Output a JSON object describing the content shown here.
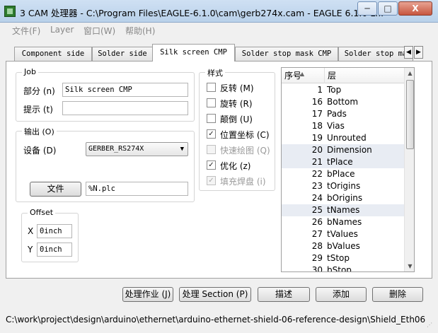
{
  "window": {
    "title": "3 CAM 处理器 - C:\\Program Files\\EAGLE-6.1.0\\cam\\gerb274x.cam - EAGLE 6.1.0 L...",
    "min_label": "─",
    "max_label": "□",
    "close_label": "X"
  },
  "menu": [
    "文件(F)",
    "Layer",
    "窗口(W)",
    "帮助(H)"
  ],
  "tabs": {
    "items": [
      "Component side",
      "Solder side",
      "Silk screen CMP",
      "Solder stop mask CMP",
      "Solder stop ma"
    ],
    "active": "Silk screen CMP",
    "scroll_right": "▶"
  },
  "job": {
    "title": "Job",
    "section_label": "部分 (n)",
    "section_value": "Silk screen CMP",
    "prompt_label": "提示 (t)",
    "prompt_value": ""
  },
  "output": {
    "title": "输出 (O)",
    "device_label": "设备 (D)",
    "device_value": "GERBER_RS274X",
    "file_button": "文件",
    "file_value": "%N.plc"
  },
  "offset": {
    "title": "Offset",
    "x_label": "X",
    "x_value": "0inch",
    "y_label": "Y",
    "y_value": "0inch"
  },
  "style": {
    "title": "样式",
    "options": [
      {
        "label": "反转 (M)",
        "checked": false,
        "enabled": true
      },
      {
        "label": "旋转 (R)",
        "checked": false,
        "enabled": true
      },
      {
        "label": "颠倒 (U)",
        "checked": false,
        "enabled": true
      },
      {
        "label": "位置坐标 (C)",
        "checked": true,
        "enabled": true
      },
      {
        "label": "快速绘图 (Q)",
        "checked": false,
        "enabled": false
      },
      {
        "label": "优化 (z)",
        "checked": true,
        "enabled": true
      },
      {
        "label": "填充焊盘 (i)",
        "checked": true,
        "enabled": false
      }
    ]
  },
  "layers": {
    "col_num": "序号",
    "col_name": "层",
    "rows": [
      {
        "num": "1",
        "name": "Top",
        "selected": false
      },
      {
        "num": "16",
        "name": "Bottom",
        "selected": false
      },
      {
        "num": "17",
        "name": "Pads",
        "selected": false
      },
      {
        "num": "18",
        "name": "Vias",
        "selected": false
      },
      {
        "num": "19",
        "name": "Unrouted",
        "selected": false
      },
      {
        "num": "20",
        "name": "Dimension",
        "selected": true
      },
      {
        "num": "21",
        "name": "tPlace",
        "selected": true
      },
      {
        "num": "22",
        "name": "bPlace",
        "selected": false
      },
      {
        "num": "23",
        "name": "tOrigins",
        "selected": false
      },
      {
        "num": "24",
        "name": "bOrigins",
        "selected": false
      },
      {
        "num": "25",
        "name": "tNames",
        "selected": true
      },
      {
        "num": "26",
        "name": "bNames",
        "selected": false
      },
      {
        "num": "27",
        "name": "tValues",
        "selected": false
      },
      {
        "num": "28",
        "name": "bValues",
        "selected": false
      },
      {
        "num": "29",
        "name": "tStop",
        "selected": false
      },
      {
        "num": "30",
        "name": "bStop",
        "selected": false
      }
    ]
  },
  "buttons": {
    "process_job": "处理作业 (J)",
    "process_section": "处理 Section (P)",
    "describe": "描述",
    "add": "添加",
    "delete": "删除"
  },
  "status": "C:\\work\\project\\design\\arduino\\ethernet\\arduino-ethernet-shield-06-reference-design\\Shield_Eth06"
}
